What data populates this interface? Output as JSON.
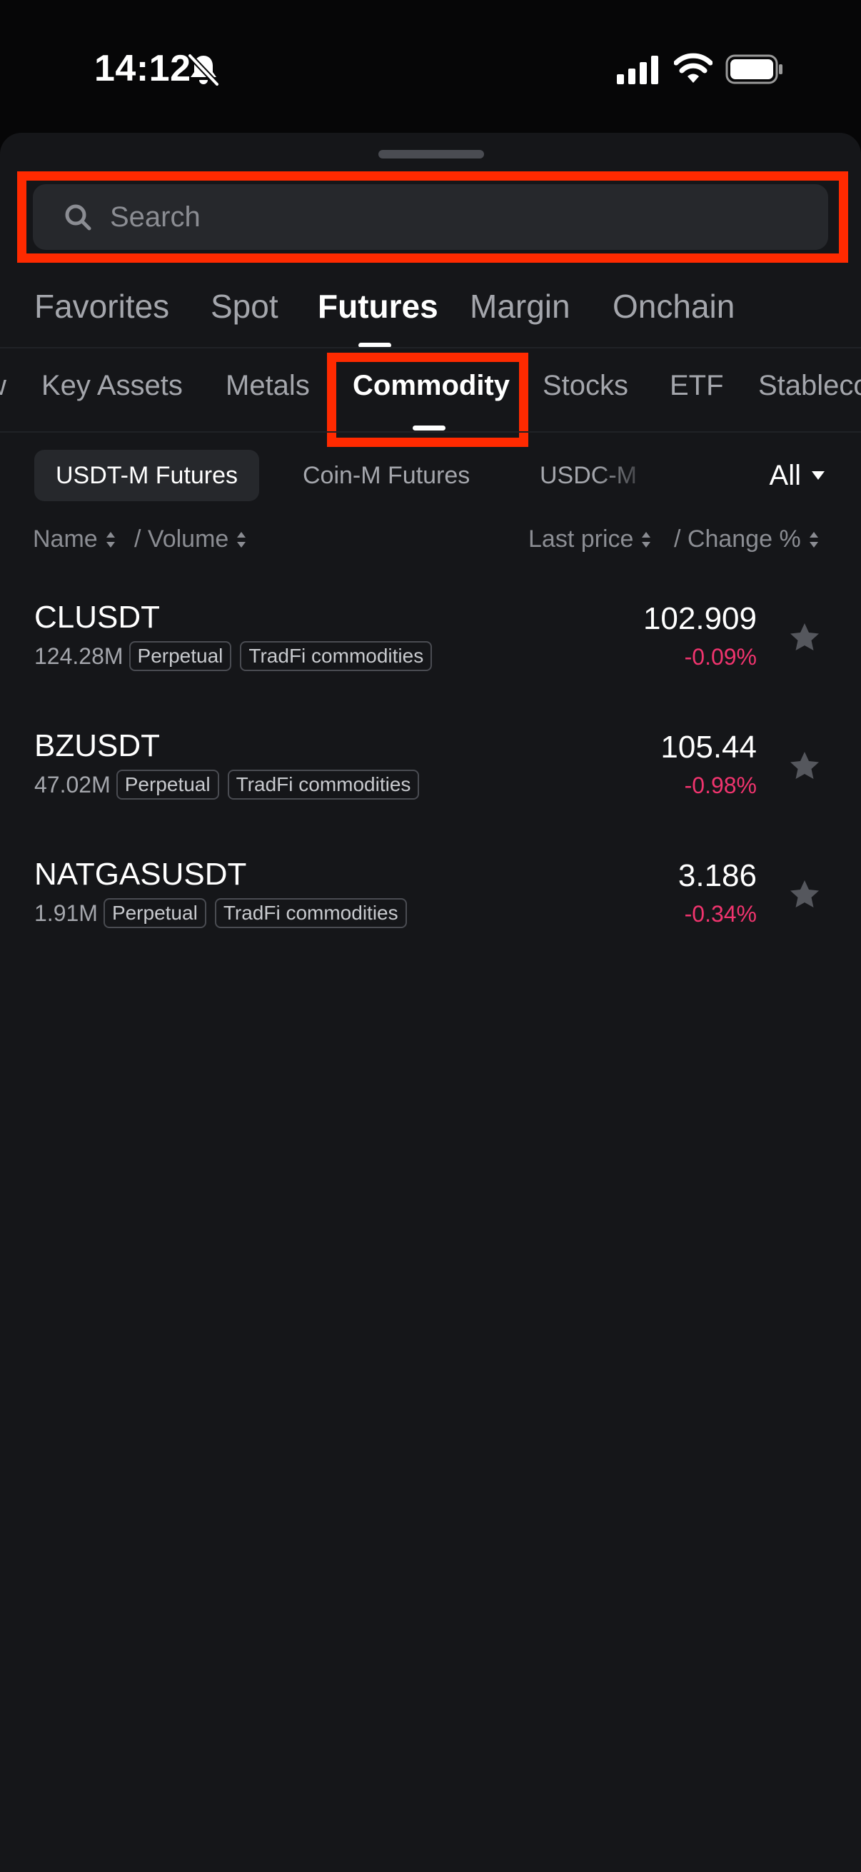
{
  "status_bar": {
    "time": "14:12",
    "icons": [
      "bell-slash-icon",
      "cellular-signal-icon",
      "wifi-icon",
      "battery-icon"
    ]
  },
  "search": {
    "placeholder": "Search",
    "value": ""
  },
  "main_tabs": [
    "Favorites",
    "Spot",
    "Futures",
    "Margin",
    "Onchain"
  ],
  "main_tab_active": "Futures",
  "sub_tabs": [
    "w",
    "Key Assets",
    "Metals",
    "Commodity",
    "Stocks",
    "ETF",
    "Stablecoins"
  ],
  "sub_tab_active": "Commodity",
  "contract_types": [
    "USDT-M Futures",
    "Coin-M Futures",
    "USDC-M"
  ],
  "contract_type_active": "USDT-M Futures",
  "filter": {
    "label": "All"
  },
  "columns": {
    "name": "Name",
    "volume": "/ Volume",
    "last_price": "Last price",
    "change": "/ Change %"
  },
  "rows": [
    {
      "symbol": "CLUSDT",
      "volume": "124.28M",
      "tags": [
        "Perpetual",
        "TradFi commodities"
      ],
      "price": "102.909",
      "change": "-0.09%"
    },
    {
      "symbol": "BZUSDT",
      "volume": "47.02M",
      "tags": [
        "Perpetual",
        "TradFi commodities"
      ],
      "price": "105.44",
      "change": "-0.98%"
    },
    {
      "symbol": "NATGASUSDT",
      "volume": "1.91M",
      "tags": [
        "Perpetual",
        "TradFi commodities"
      ],
      "price": "3.186",
      "change": "-0.34%"
    }
  ],
  "colors": {
    "negative": "#f0346e",
    "highlight": "#ff2a00",
    "background": "#151619",
    "star": "#55575d"
  }
}
